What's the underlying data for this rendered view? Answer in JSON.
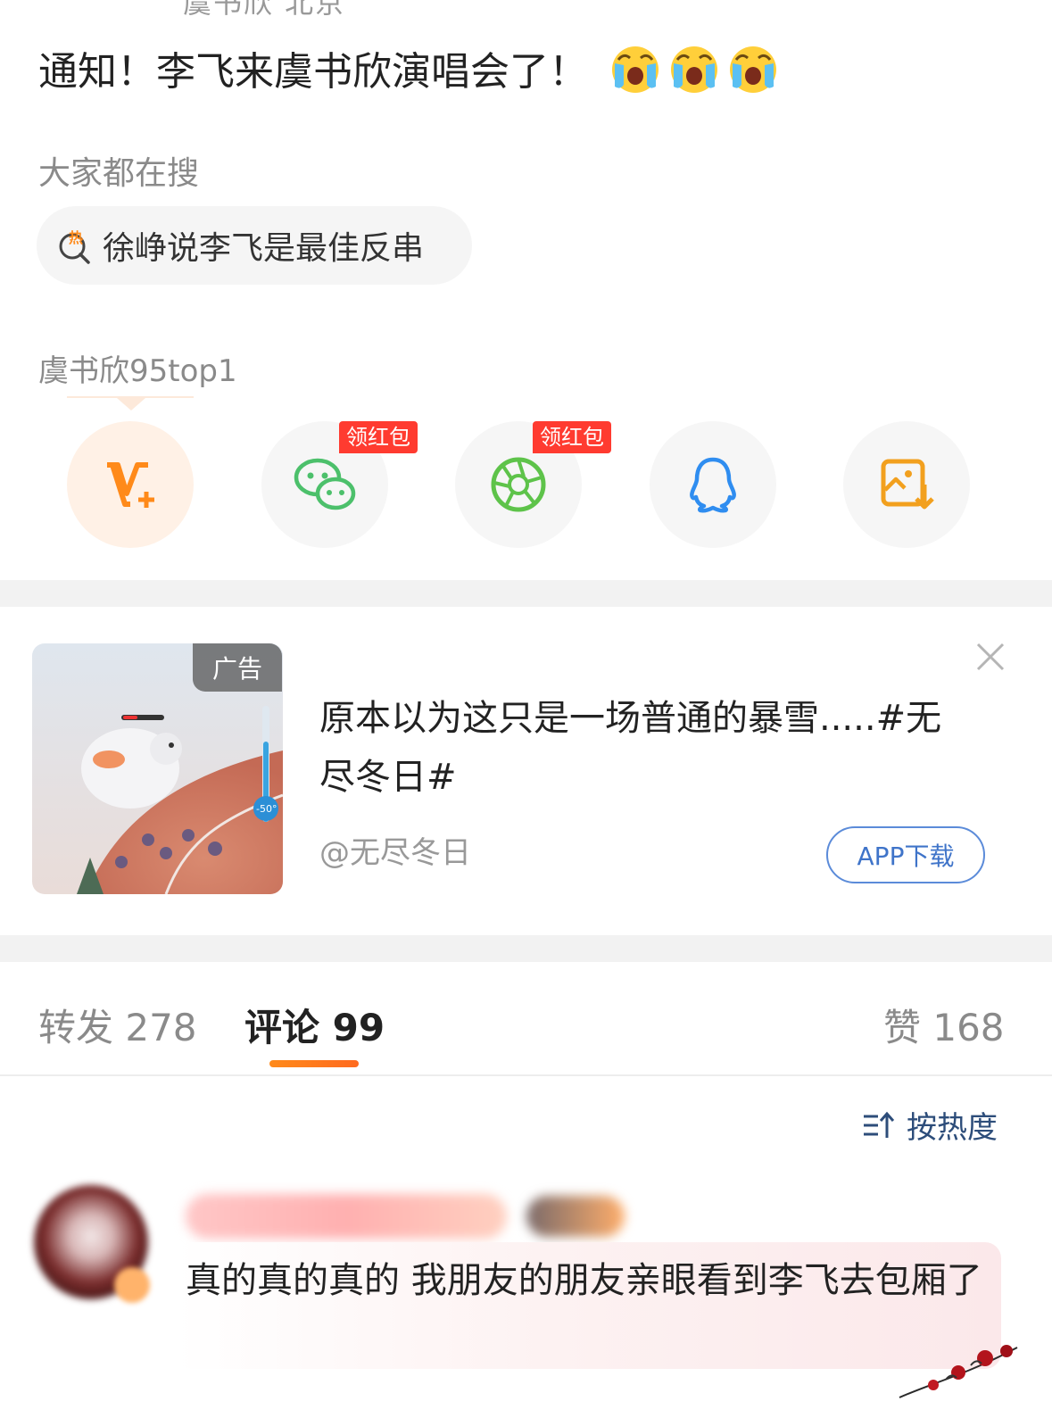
{
  "top_cut": "虞书欣 北京",
  "post": {
    "text": "通知！李飞来虞书欣演唱会了！",
    "emojis": [
      "cry-emoji",
      "cry-emoji",
      "cry-emoji"
    ]
  },
  "search": {
    "title": "大家都在搜",
    "chip_icon": "hot-search-icon",
    "chip_text": "徐峥说李飞是最佳反串"
  },
  "hashtag": "虞书欣95top1",
  "share": {
    "items": [
      {
        "name": "vplus-icon",
        "badge": ""
      },
      {
        "name": "wechat-icon",
        "badge": "领红包"
      },
      {
        "name": "moments-icon",
        "badge": "领红包"
      },
      {
        "name": "qq-icon",
        "badge": ""
      },
      {
        "name": "save-image-icon",
        "badge": ""
      }
    ]
  },
  "ad": {
    "tag": "广告",
    "title": "原本以为这只是一场普通的暴雪.....#无尽冬日#",
    "source": "@无尽冬日",
    "button": "APP下载",
    "game_meter": "-50°"
  },
  "tabs": {
    "repost": "转发 278",
    "comment": "评论 99",
    "like": "赞 168"
  },
  "sort": {
    "icon": "sort-icon",
    "label": "按热度"
  },
  "comment": {
    "text": "真的真的真的 我朋友的朋友亲眼看到李飞去包厢了"
  },
  "colors": {
    "accent_orange": "#ff8a1a",
    "badge_red": "#ff3b30",
    "link_blue": "#3f74c9",
    "wechat_green": "#4cc06b",
    "qq_blue": "#2f8df0"
  }
}
